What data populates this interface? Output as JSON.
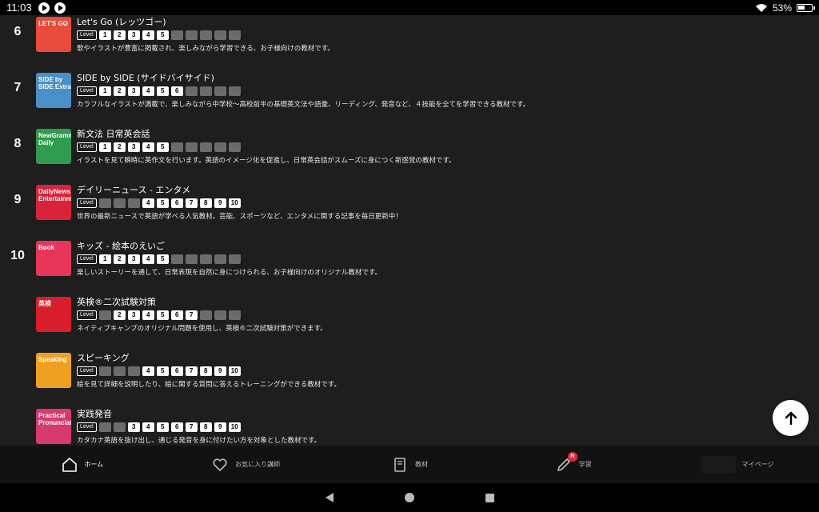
{
  "status_bar": {
    "time": "11:03",
    "battery": "53%",
    "battery_level": 0.53
  },
  "level_tag": "Level",
  "courses": [
    {
      "rank": "6",
      "title": "Let's Go (レッツゴー)",
      "thumb_label": "LET'S GO",
      "thumb_color": "#e94b3c",
      "levels": [
        1,
        1,
        1,
        1,
        1,
        0,
        0,
        0,
        0,
        0
      ],
      "description": "歌やイラストが豊富に掲載され、楽しみながら学習できる、お子様向けの教材です。"
    },
    {
      "rank": "7",
      "title": "SIDE by SIDE (サイドバイサイド)",
      "thumb_label": "SIDE by SIDE Extra",
      "thumb_color": "#4a90c8",
      "levels": [
        1,
        1,
        1,
        1,
        1,
        1,
        0,
        0,
        0,
        0
      ],
      "description": "カラフルなイラストが満載で、楽しみながら中学校〜高校前半の基礎英文法や語彙、リーディング、発音など、４技能を全てを学習できる教材です。"
    },
    {
      "rank": "8",
      "title": "新文法 日常英会話",
      "thumb_label": "NewGrammar Daily",
      "thumb_color": "#2e9b4e",
      "levels": [
        1,
        1,
        1,
        1,
        1,
        0,
        0,
        0,
        0,
        0
      ],
      "description": "イラストを見て瞬時に英作文を行います。英語のイメージ化を促進し、日常英会話がスムーズに身につく新感覚の教材です。"
    },
    {
      "rank": "9",
      "title": "デイリーニュース - エンタメ",
      "thumb_label": "DailyNews Entertainment",
      "thumb_color": "#d8243b",
      "levels": [
        0,
        0,
        0,
        1,
        1,
        1,
        1,
        1,
        1,
        1
      ],
      "description": "世界の最新ニュースで英語が学べる人気教材。芸能、スポーツなど、エンタメに関する記事を毎日更新中！"
    },
    {
      "rank": "10",
      "title": "キッズ - 絵本のえいご",
      "thumb_label": "Book",
      "thumb_color": "#e8365a",
      "levels": [
        1,
        1,
        1,
        1,
        1,
        0,
        0,
        0,
        0,
        0
      ],
      "description": "楽しいストーリーを通して、日常表現を自然に身につけられる、お子様向けのオリジナル教材です。"
    },
    {
      "rank": "",
      "title": "英検®二次試験対策",
      "thumb_label": "英検",
      "thumb_color": "#d81e2a",
      "levels": [
        0,
        1,
        1,
        1,
        1,
        1,
        1,
        0,
        0,
        0
      ],
      "description": "ネイティブキャンプのオリジナル問題を使用し、英検®二次試験対策ができます。"
    },
    {
      "rank": "",
      "title": "スピーキング",
      "thumb_label": "Speaking",
      "thumb_color": "#f0a020",
      "levels": [
        0,
        0,
        0,
        1,
        1,
        1,
        1,
        1,
        1,
        1
      ],
      "description": "絵を見て詳細を説明したり、絵に関する質問に答えるトレーニングができる教材です。"
    },
    {
      "rank": "",
      "title": "実践発音",
      "thumb_label": "Practical Pronunciation",
      "thumb_color": "#d63a6e",
      "levels": [
        0,
        0,
        1,
        1,
        1,
        1,
        1,
        1,
        1,
        1
      ],
      "description": "カタカナ英語を抜け出し、通じる発音を身に付けたい方を対象とした教材です。"
    }
  ],
  "bottom_nav": [
    {
      "label": "ホーム",
      "icon": "home-icon",
      "active": true
    },
    {
      "label": "お気に入り講師",
      "icon": "heart-icon",
      "active": false
    },
    {
      "label": "教材",
      "icon": "book-icon",
      "active": false
    },
    {
      "label": "学習",
      "icon": "pencil-icon",
      "active": false,
      "badge": "N"
    },
    {
      "label": "マイページ",
      "icon": "avatar-icon",
      "active": false
    }
  ]
}
